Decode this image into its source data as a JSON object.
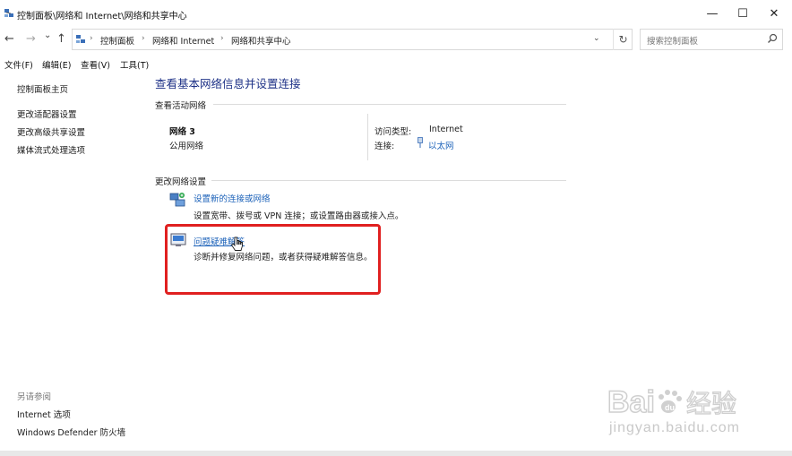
{
  "window": {
    "title": "控制面板\\网络和 Internet\\网络和共享中心",
    "minimize": "—",
    "maximize": "☐",
    "close": "✕"
  },
  "nav": {
    "back": "←",
    "forward": "→",
    "history": "⌄",
    "up": "↑",
    "breadcrumb": [
      "控制面板",
      "网络和 Internet",
      "网络和共享中心"
    ],
    "breadcrumb_sep": "›",
    "dropdown": "⌄",
    "refresh": "↻"
  },
  "search": {
    "placeholder": "搜索控制面板"
  },
  "menu": [
    "文件(F)",
    "编辑(E)",
    "查看(V)",
    "工具(T)"
  ],
  "sidebar": {
    "home": "控制面板主页",
    "links": [
      "更改适配器设置",
      "更改高级共享设置",
      "媒体流式处理选项"
    ],
    "see_also_title": "另请参阅",
    "see_also": [
      "Internet 选项",
      "Windows Defender 防火墙"
    ]
  },
  "main": {
    "heading": "查看基本网络信息并设置连接",
    "active_section": "查看活动网络",
    "network": {
      "name": "网络 3",
      "category": "公用网络",
      "access_label": "访问类型:",
      "access_value": "Internet",
      "conn_label": "连接:",
      "conn_value": "以太网"
    },
    "change_section": "更改网络设置",
    "actions": [
      {
        "title": "设置新的连接或网络",
        "desc": "设置宽带、拨号或 VPN 连接；或设置路由器或接入点。",
        "icon": "network-setup-icon"
      },
      {
        "title": "问题疑难解答",
        "desc": "诊断并修复网络问题，或者获得疑难解答信息。",
        "icon": "troubleshoot-icon"
      }
    ]
  },
  "watermark": {
    "brand": "Bai du 经验",
    "sub": "jingyan.baidu.com"
  },
  "colors": {
    "link": "#1c62b9",
    "heading": "#1e3287",
    "highlight": "#e02020"
  }
}
